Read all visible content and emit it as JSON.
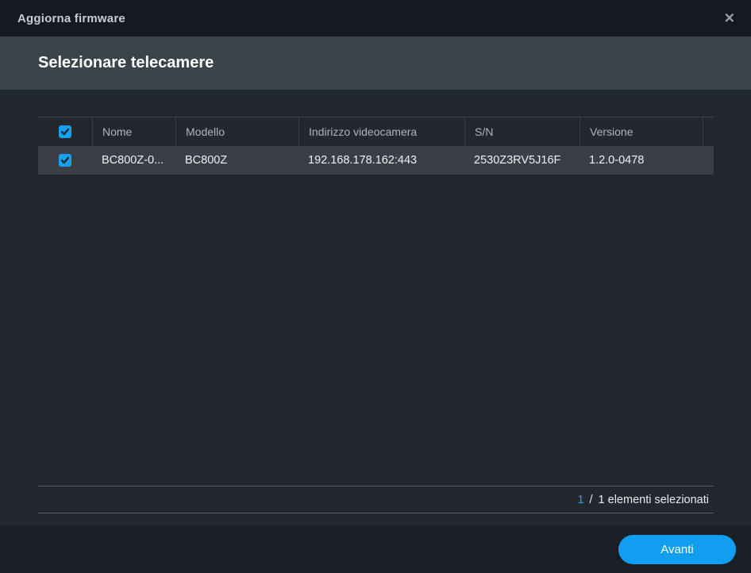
{
  "dialog": {
    "title": "Aggiorna firmware",
    "close_icon": "✕"
  },
  "header": {
    "subtitle": "Selezionare telecamere"
  },
  "table": {
    "columns": [
      "",
      "Nome",
      "Modello",
      "Indirizzo videocamera",
      "S/N",
      "Versione",
      ""
    ],
    "header_checkbox_checked": true,
    "rows": [
      {
        "checked": true,
        "name": "BC800Z-0...",
        "model": "BC800Z",
        "address": "192.168.178.162:443",
        "serial": "2530Z3RV5J16F",
        "version": "1.2.0-0478"
      }
    ]
  },
  "pagination": {
    "page": "1",
    "separator": "/",
    "selection_text": "1 elementi selezionati"
  },
  "footer": {
    "next_label": "Avanti"
  },
  "colors": {
    "accent_blue": "#109ff0",
    "checkbox_blue": "#18a0ee",
    "link_blue": "#2e9fe9",
    "subheader_bg": "#3d434b",
    "row_bg": "#3a3f47",
    "titlebar_bg": "#16191f"
  }
}
